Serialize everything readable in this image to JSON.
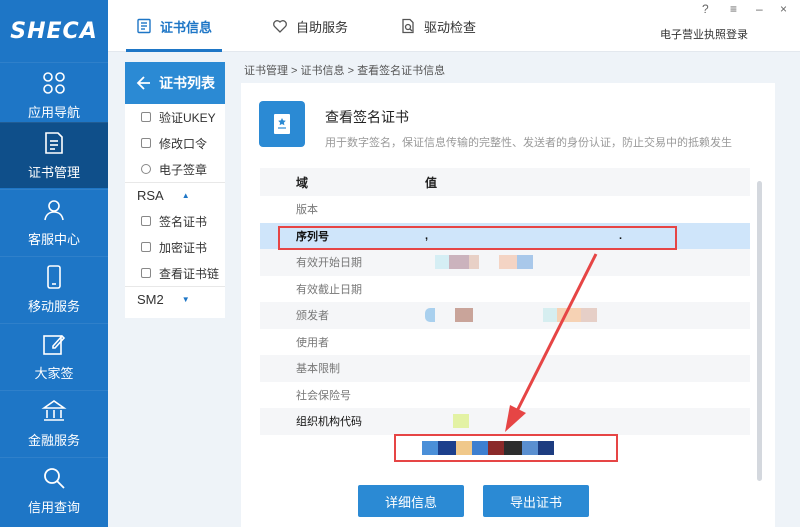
{
  "app": {
    "logo_text": "SHECA"
  },
  "leftnav": {
    "items": [
      {
        "label": "应用导航",
        "icon": "grid-icon"
      },
      {
        "label": "证书管理",
        "icon": "document-icon",
        "active": true
      },
      {
        "label": "客服中心",
        "icon": "user-icon"
      },
      {
        "label": "移动服务",
        "icon": "phone-icon"
      },
      {
        "label": "大家签",
        "icon": "edit-icon"
      },
      {
        "label": "金融服务",
        "icon": "bank-icon"
      },
      {
        "label": "信用查询",
        "icon": "search-icon"
      }
    ]
  },
  "topbar": {
    "tabs": [
      {
        "label": "证书信息",
        "icon": "list-icon",
        "active": true
      },
      {
        "label": "自助服务",
        "icon": "heart-icon"
      },
      {
        "label": "驱动检查",
        "icon": "search-doc-icon"
      }
    ],
    "license": "电子营业执照登录",
    "window": {
      "help": "?",
      "menu": "≡",
      "minimize": "–",
      "close": "×"
    }
  },
  "submenu": {
    "title": "证书列表",
    "items": [
      {
        "label": "验证UKEY"
      },
      {
        "label": "修改口令"
      },
      {
        "label": "电子签章"
      }
    ],
    "group1": "RSA",
    "group1_items": [
      {
        "label": "签名证书"
      },
      {
        "label": "加密证书"
      },
      {
        "label": "查看证书链"
      }
    ],
    "group2": "SM2"
  },
  "breadcrumb": "证书管理 > 证书信息 > 查看签名证书信息",
  "panel": {
    "title": "查看签名证书",
    "desc": "用于数字签名，保证信息传输的完整性、发送者的身份认证，防止交易中的抵赖发生",
    "table": {
      "headers": [
        "域",
        "值"
      ],
      "rows": [
        {
          "field": "版本"
        },
        {
          "field": "序列号",
          "value_start": ",",
          "value_end": "."
        },
        {
          "field": "有效开始日期"
        },
        {
          "field": "有效截止日期"
        },
        {
          "field": "颁发者"
        },
        {
          "field": "使用者"
        },
        {
          "field": "基本限制"
        },
        {
          "field": "社会保险号"
        },
        {
          "field": "组织机构代码"
        }
      ]
    },
    "buttons": {
      "detail": "详细信息",
      "export": "导出证书"
    }
  },
  "colors": {
    "accent": "#1e76c6",
    "highlight_row": "#cfe5fa",
    "annotation": "#e64545"
  }
}
